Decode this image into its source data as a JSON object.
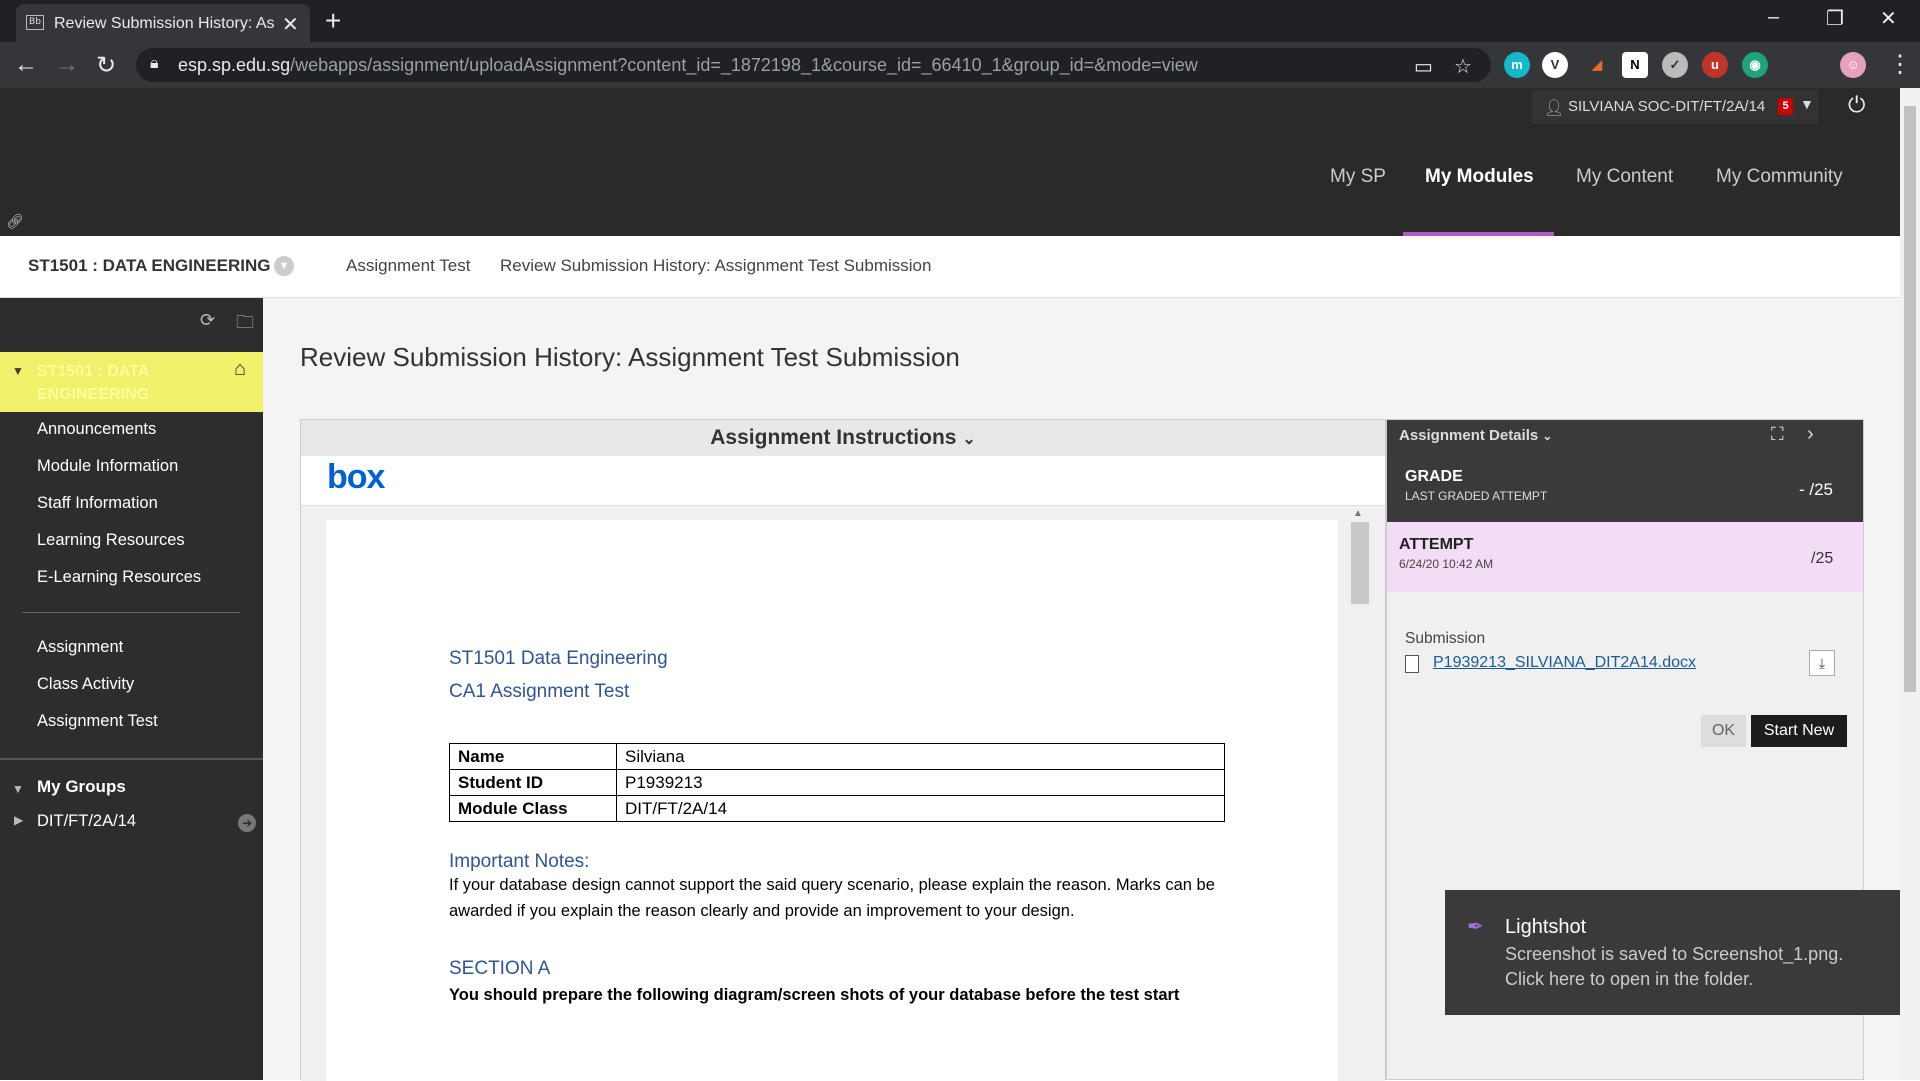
{
  "browser": {
    "tab_title": "Review Submission History: Assig",
    "tab_favicon": "Bb",
    "url_host": "esp.sp.edu.sg",
    "url_path": "/webapps/assignment/uploadAssignment?content_id=_1872198_1&course_id=_66410_1&group_id=&mode=view"
  },
  "header": {
    "user_name": "SILVIANA SOC-DIT/FT/2A/14",
    "notification_count": "5",
    "nav": [
      "My SP",
      "My Modules",
      "My Content",
      "My Community"
    ],
    "active_nav": "My Modules"
  },
  "breadcrumb": {
    "course": "ST1501 : DATA ENGINEERING",
    "items": [
      "Assignment Test",
      "Review Submission History: Assignment Test Submission"
    ]
  },
  "sidebar": {
    "course_title": "ST1501 : DATA ENGINEERING",
    "items": [
      "Announcements",
      "Module Information",
      "Staff Information",
      "Learning Resources",
      "E-Learning Resources"
    ],
    "items2": [
      "Assignment",
      "Class Activity",
      "Assignment Test"
    ],
    "groups_label": "My Groups",
    "groups": [
      "DIT/FT/2A/14"
    ]
  },
  "main": {
    "page_title": "Review Submission History: Assignment Test Submission",
    "instructions_label": "Assignment Instructions",
    "box_logo": "box",
    "doc": {
      "title1": "ST1501 Data Engineering",
      "title2": "CA1 Assignment Test",
      "table": [
        {
          "k": "Name",
          "v": "Silviana"
        },
        {
          "k": "Student ID",
          "v": "P1939213"
        },
        {
          "k": "Module Class",
          "v": "DIT/FT/2A/14"
        }
      ],
      "notes_heading": "Important Notes:",
      "notes_text": "If your database design cannot support the said query scenario, please explain the reason. Marks can be awarded if you explain the reason clearly and provide an improvement to your design.",
      "section_heading": "SECTION A",
      "section_text": "You should prepare the following diagram/screen shots of your database before the test start"
    }
  },
  "details": {
    "title": "Assignment Details",
    "grade_label": "GRADE",
    "grade_sub": "LAST GRADED ATTEMPT",
    "grade_value": "- /25",
    "attempt_label": "ATTEMPT",
    "attempt_date": "6/24/20 10:42 AM",
    "attempt_value": "/25",
    "submission_label": "Submission",
    "file_name": "P1939213_SILVIANA_DIT2A14.docx",
    "ok_label": "OK",
    "start_new_label": "Start New"
  },
  "toast": {
    "title": "Lightshot",
    "message": "Screenshot is saved to Screenshot_1.png. Click here to open in the folder."
  }
}
